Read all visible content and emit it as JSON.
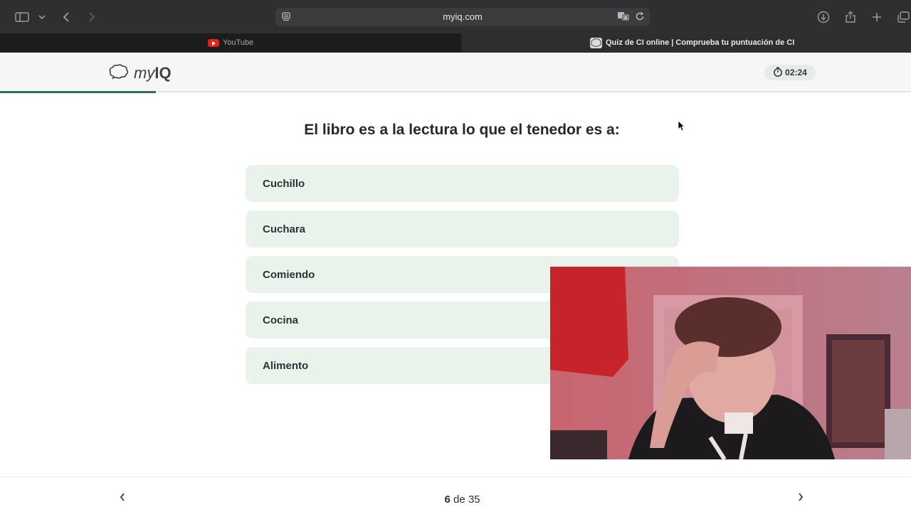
{
  "browser": {
    "url": "myiq.com",
    "tabs": [
      {
        "label": "YouTube",
        "active": false
      },
      {
        "label": "Quiz de CI online | Comprueba tu puntuación de CI",
        "active": true
      }
    ]
  },
  "header": {
    "logo_prefix": "my",
    "logo_suffix": "IQ",
    "timer": "02:24",
    "progress_fraction": 0.171
  },
  "quiz": {
    "question": "El libro es a la lectura lo que el tenedor es a:",
    "options": [
      "Cuchillo",
      "Cuchara",
      "Comiendo",
      "Cocina",
      "Alimento"
    ]
  },
  "footer": {
    "current": "6",
    "separator": "de",
    "total": "35"
  },
  "colors": {
    "accent": "#2f6f5a",
    "option_bg": "#e9f3ec",
    "toolbar_bg": "#2f2f31"
  },
  "icons": [
    "sidebar-icon",
    "chevron-down-icon",
    "back-icon",
    "forward-icon",
    "reader-icon",
    "translate-icon",
    "reload-icon",
    "download-icon",
    "share-icon",
    "plus-icon",
    "tabs-overview-icon",
    "brain-icon",
    "stopwatch-icon",
    "chevron-left-icon",
    "chevron-right-icon"
  ]
}
